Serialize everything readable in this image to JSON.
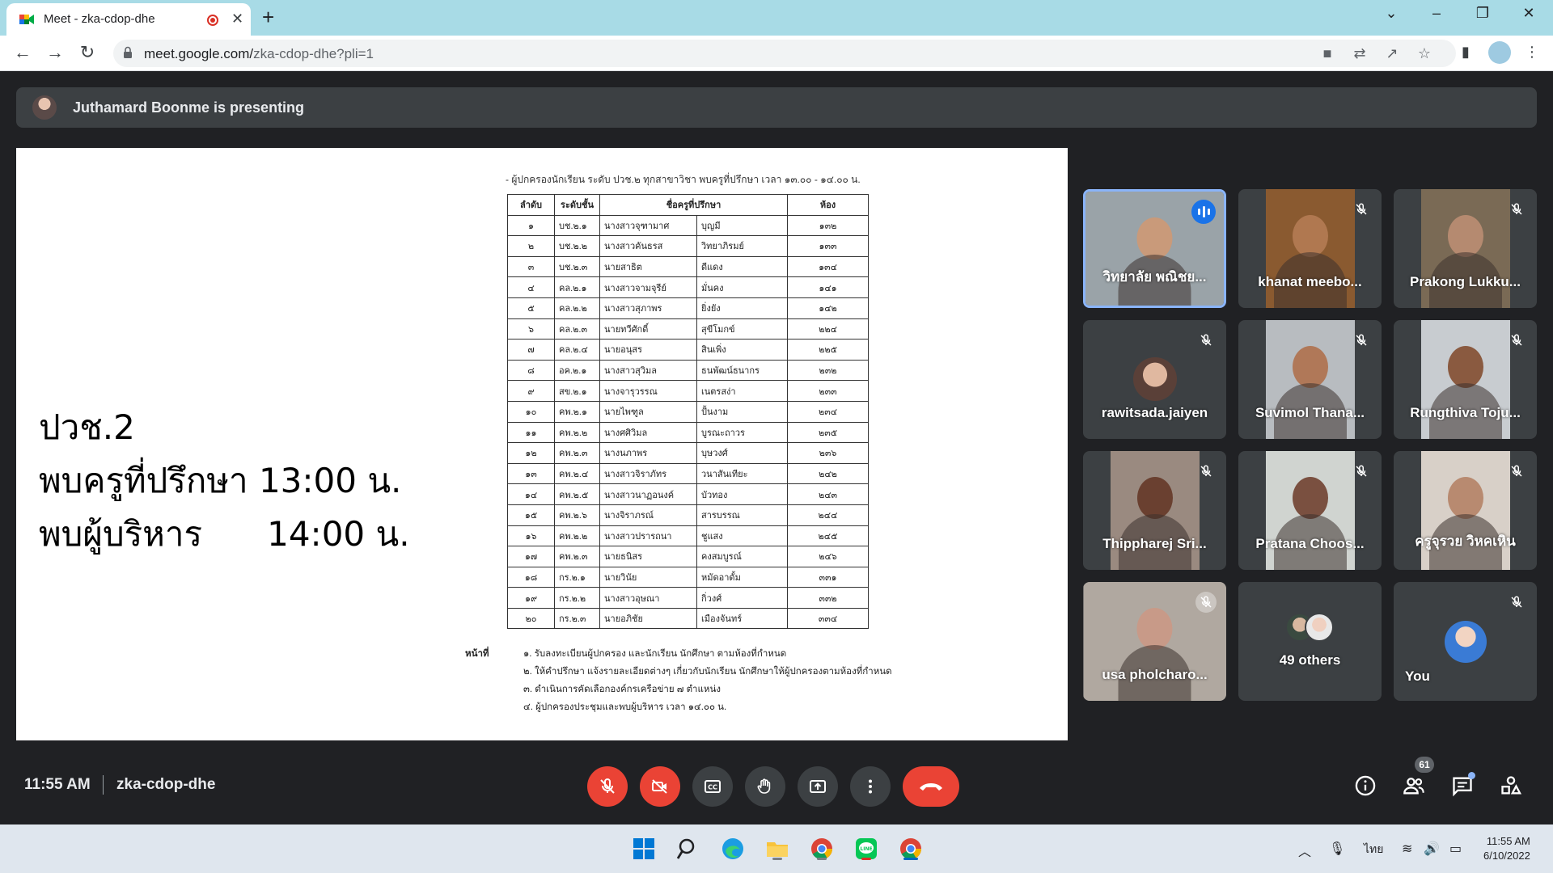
{
  "browser": {
    "tab_title": "Meet - zka-cdop-dhe",
    "url_host": "meet.google.com/",
    "url_path": "zka-cdop-dhe?pli=1"
  },
  "meet": {
    "presenting_text": "Juthamard Boonme is presenting",
    "clock": "11:55 AM",
    "meeting_code": "zka-cdop-dhe",
    "people_count": "61"
  },
  "slide": {
    "line1": "ปวช.2",
    "line2": "พบครูที่ปรึกษา 13:00 น.",
    "line3": "พบผู้บริหาร      14:00 น."
  },
  "document": {
    "header": "- ผู้ปกครองนักเรียน ระดับ ปวช.๒ ทุกสาขาวิชา พบครูที่ปรึกษา เวลา ๑๓.๐๐ - ๑๔.๐๐ น.",
    "columns": [
      "ลำดับ",
      "ระดับชั้น",
      "ชื่อครูที่ปรึกษา",
      "",
      "ห้อง"
    ],
    "rows": [
      [
        "๑",
        "บช.๒.๑",
        "นางสาวจุฑามาศ",
        "บุญมี",
        "๑๓๒"
      ],
      [
        "๒",
        "บช.๒.๒",
        "นางสาวคันธรส",
        "วิทยาภิรมย์",
        "๑๓๓"
      ],
      [
        "๓",
        "บช.๒.๓",
        "นายสาธิต",
        "ดีแดง",
        "๑๓๔"
      ],
      [
        "๔",
        "คล.๒.๑",
        "นางสาวจามจุรีย์",
        "มั่นคง",
        "๑๔๑"
      ],
      [
        "๕",
        "คล.๒.๒",
        "นางสาวสุภาพร",
        "ยิ่งยัง",
        "๑๔๒"
      ],
      [
        "๖",
        "คล.๒.๓",
        "นายทวีศักดิ์",
        "สุขีโมกข์",
        "๒๒๔"
      ],
      [
        "๗",
        "คล.๒.๔",
        "นายอนุสร",
        "สินเพิ่ง",
        "๒๒๕"
      ],
      [
        "๘",
        "อค.๒.๑",
        "นางสาวสุวิมล",
        "ธนพัฒน์ธนากร",
        "๒๓๒"
      ],
      [
        "๙",
        "สข.๒.๑",
        "นางจารุวรรณ",
        "เนตรสง่า",
        "๒๓๓"
      ],
      [
        "๑๐",
        "คพ.๒.๑",
        "นายไพฑูล",
        "ปั้นงาม",
        "๒๓๔"
      ],
      [
        "๑๑",
        "คพ.๒.๒",
        "นางศศิวิมล",
        "บูรณะถาวร",
        "๒๓๕"
      ],
      [
        "๑๒",
        "คพ.๒.๓",
        "นางนภาพร",
        "บุษวงศ์",
        "๒๓๖"
      ],
      [
        "๑๓",
        "คพ.๒.๔",
        "นางสาวจิราภัทร",
        "วนาสันเทียะ",
        "๒๔๒"
      ],
      [
        "๑๔",
        "คพ.๒.๕",
        "นางสาวนาฏอนงค์",
        "บัวทอง",
        "๒๔๓"
      ],
      [
        "๑๕",
        "คพ.๒.๖",
        "นางจิราภรณ์",
        "สารบรรณ",
        "๒๔๔"
      ],
      [
        "๑๖",
        "คพ.๒.๒",
        "นางสาวปรารถนา",
        "ชูแสง",
        "๒๔๕"
      ],
      [
        "๑๗",
        "คพ.๒.๓",
        "นายธนิสร",
        "คงสมบูรณ์",
        "๒๔๖"
      ],
      [
        "๑๘",
        "กร.๒.๑",
        "นายวินัย",
        "หมัดอาดั้ม",
        "๓๓๑"
      ],
      [
        "๑๙",
        "กร.๒.๒",
        "นางสาวอุษณา",
        "กิ่วงศ์",
        "๓๓๒"
      ],
      [
        "๒๐",
        "กร.๒.๓",
        "นายอภิชัย",
        "เมืองจันทร์",
        "๓๓๔"
      ]
    ],
    "notes_label": "หน้าที่",
    "notes": [
      "๑. รับลงทะเบียนผู้ปกครอง และนักเรียน นักศึกษา ตามห้องที่กำหนด",
      "๒. ให้คำปรึกษา แจ้งรายละเอียดต่างๆ เกี่ยวกับนักเรียน นักศึกษาให้ผู้ปกครองตามห้องที่กำหนด",
      "๓. ดำเนินการคัดเลือกองค์กรเครือข่าย ๗ ตำแหน่ง",
      "๔. ผู้ปกครองประชุมและพบผู้บริหาร เวลา ๑๔.๐๐ น."
    ]
  },
  "participants": [
    {
      "name": "วิทยาลัย พณิชย...",
      "bg": "#9aa3a8",
      "skin": "#c99a7a",
      "active": true
    },
    {
      "name": "khanat meebo...",
      "bg": "#8a5a30",
      "skin": "#b07850"
    },
    {
      "name": "Prakong Lukku...",
      "bg": "#7a6a55",
      "skin": "#b58a70"
    },
    {
      "name": "rawitsada.jaiyen",
      "bg": "#3c4043",
      "skin": "#e0b8a0"
    },
    {
      "name": "Suvimol Thana...",
      "bg": "#b8bcc0",
      "skin": "#b07858"
    },
    {
      "name": "Rungthiva Toju...",
      "bg": "#c8ccd0",
      "skin": "#8a5a40"
    },
    {
      "name": "Thippharej Sri...",
      "bg": "#9a8a80",
      "skin": "#6a4030"
    },
    {
      "name": "Pratana Choos...",
      "bg": "#d0d4d0",
      "skin": "#7a5040"
    },
    {
      "name": "ครูจุรวย วิหคเหิน",
      "bg": "#d8d0c8",
      "skin": "#b88a70"
    },
    {
      "name": "usa pholcharo...",
      "bg": "#b0a8a0",
      "skin": "#c89a88"
    },
    {
      "name": "49 others"
    },
    {
      "name": "You"
    }
  ],
  "taskbar": {
    "time": "11:55 AM",
    "date": "6/10/2022",
    "lang": "ไทย"
  }
}
